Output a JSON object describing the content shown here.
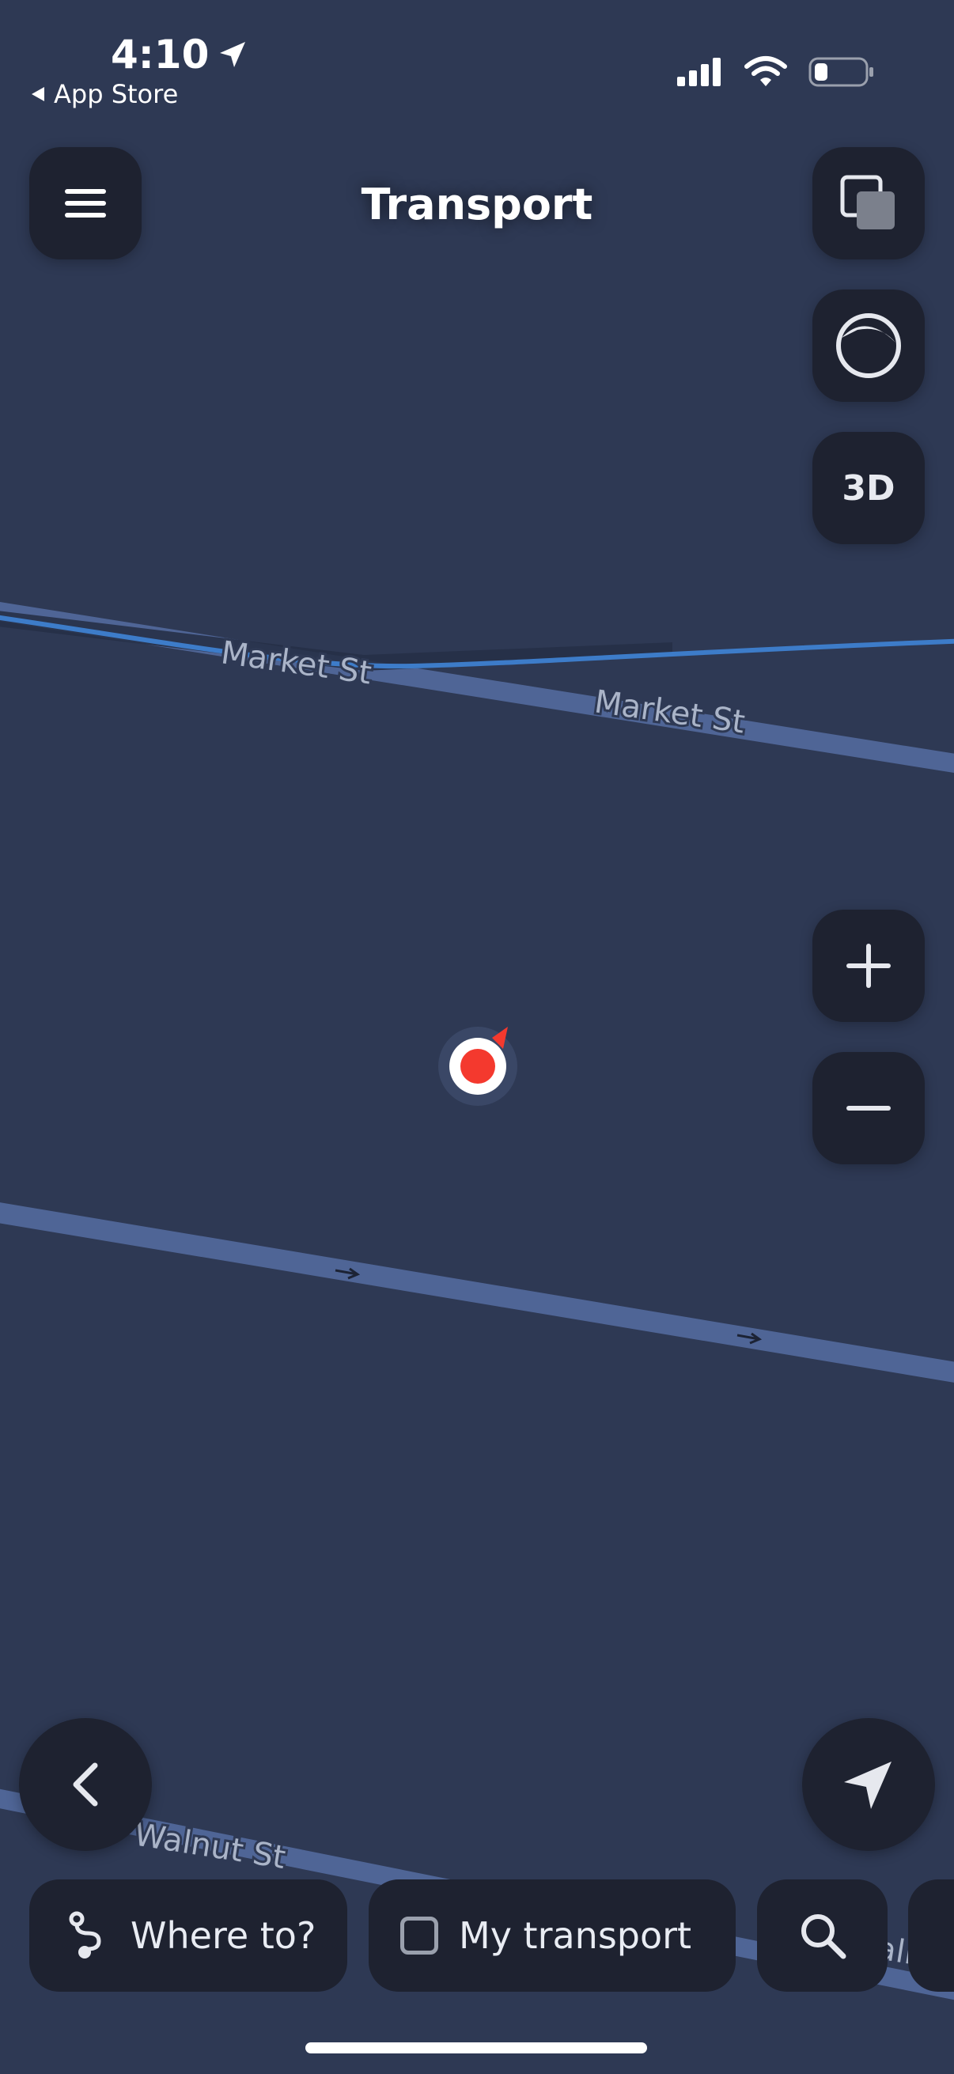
{
  "status_bar": {
    "time": "4:10",
    "back_label": "App Store"
  },
  "map": {
    "streets": [
      {
        "name": "Market St"
      },
      {
        "name": "Market St"
      },
      {
        "name": "Walnut St"
      },
      {
        "name": "Walnut St"
      }
    ]
  },
  "header": {
    "title": "Transport"
  },
  "controls": {
    "three_d_label": "3D"
  },
  "bottom_bar": {
    "where_to_label": "Where to?",
    "my_transport_label": "My transport"
  },
  "colors": {
    "map_background": "#2e3954",
    "road": "#4f6596",
    "transit_line": "#3d7cc9",
    "control_background": "#1e2230",
    "location_marker": "#f4392e"
  },
  "icons": {
    "menu": "menu-icon",
    "layers": "layers-icon",
    "theme": "theme-circle-icon",
    "zoom_in": "plus-icon",
    "zoom_out": "minus-icon",
    "back": "chevron-left-icon",
    "locate": "navigation-arrow-icon",
    "route": "route-icon",
    "checkbox": "checkbox-icon",
    "search": "search-icon"
  }
}
